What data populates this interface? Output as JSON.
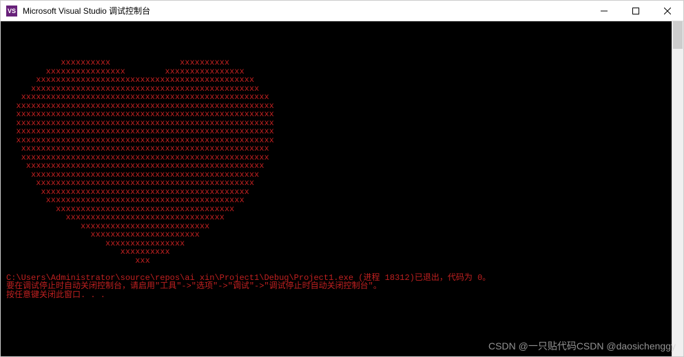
{
  "window": {
    "title": "Microsoft Visual Studio 调试控制台",
    "icon_label": "VS"
  },
  "console": {
    "heart_lines": [
      "",
      "",
      "",
      "",
      "           xxxxxxxxxx              xxxxxxxxxx",
      "        xxxxxxxxxxxxxxxx        xxxxxxxxxxxxxxxx",
      "      xxxxxxxxxxxxxxxxxxxxxxxxxxxxxxxxxxxxxxxxxxxx",
      "     xxxxxxxxxxxxxxxxxxxxxxxxxxxxxxxxxxxxxxxxxxxxxx",
      "   xxxxxxxxxxxxxxxxxxxxxxxxxxxxxxxxxxxxxxxxxxxxxxxxxx",
      "  xxxxxxxxxxxxxxxxxxxxxxxxxxxxxxxxxxxxxxxxxxxxxxxxxxxx",
      "  xxxxxxxxxxxxxxxxxxxxxxxxxxxxxxxxxxxxxxxxxxxxxxxxxxxx",
      "  xxxxxxxxxxxxxxxxxxxxxxxxxxxxxxxxxxxxxxxxxxxxxxxxxxxx",
      "  xxxxxxxxxxxxxxxxxxxxxxxxxxxxxxxxxxxxxxxxxxxxxxxxxxxx",
      "  xxxxxxxxxxxxxxxxxxxxxxxxxxxxxxxxxxxxxxxxxxxxxxxxxxxx",
      "   xxxxxxxxxxxxxxxxxxxxxxxxxxxxxxxxxxxxxxxxxxxxxxxxxx",
      "   xxxxxxxxxxxxxxxxxxxxxxxxxxxxxxxxxxxxxxxxxxxxxxxxxx",
      "    xxxxxxxxxxxxxxxxxxxxxxxxxxxxxxxxxxxxxxxxxxxxxxxx",
      "     xxxxxxxxxxxxxxxxxxxxxxxxxxxxxxxxxxxxxxxxxxxxxx",
      "      xxxxxxxxxxxxxxxxxxxxxxxxxxxxxxxxxxxxxxxxxxxx",
      "       xxxxxxxxxxxxxxxxxxxxxxxxxxxxxxxxxxxxxxxxxx",
      "        xxxxxxxxxxxxxxxxxxxxxxxxxxxxxxxxxxxxxxxx",
      "          xxxxxxxxxxxxxxxxxxxxxxxxxxxxxxxxxxxx",
      "            xxxxxxxxxxxxxxxxxxxxxxxxxxxxxxxx",
      "               xxxxxxxxxxxxxxxxxxxxxxxxxx",
      "                 xxxxxxxxxxxxxxxxxxxxxx",
      "                    xxxxxxxxxxxxxxxx",
      "                       xxxxxxxxxx",
      "                          xxx",
      ""
    ],
    "exit_line": "C:\\Users\\Administrator\\source\\repos\\ai xin\\Project1\\Debug\\Project1.exe (进程 18312)已退出，代码为 0。",
    "hint_line": "要在调试停止时自动关闭控制台，请启用\"工具\"->\"选项\"->\"调试\"->\"调试停止时自动关闭控制台\"。",
    "close_line": "按任意键关闭此窗口. . ."
  },
  "watermark": "CSDN @一只贴代码CSDN @daosichenggy"
}
